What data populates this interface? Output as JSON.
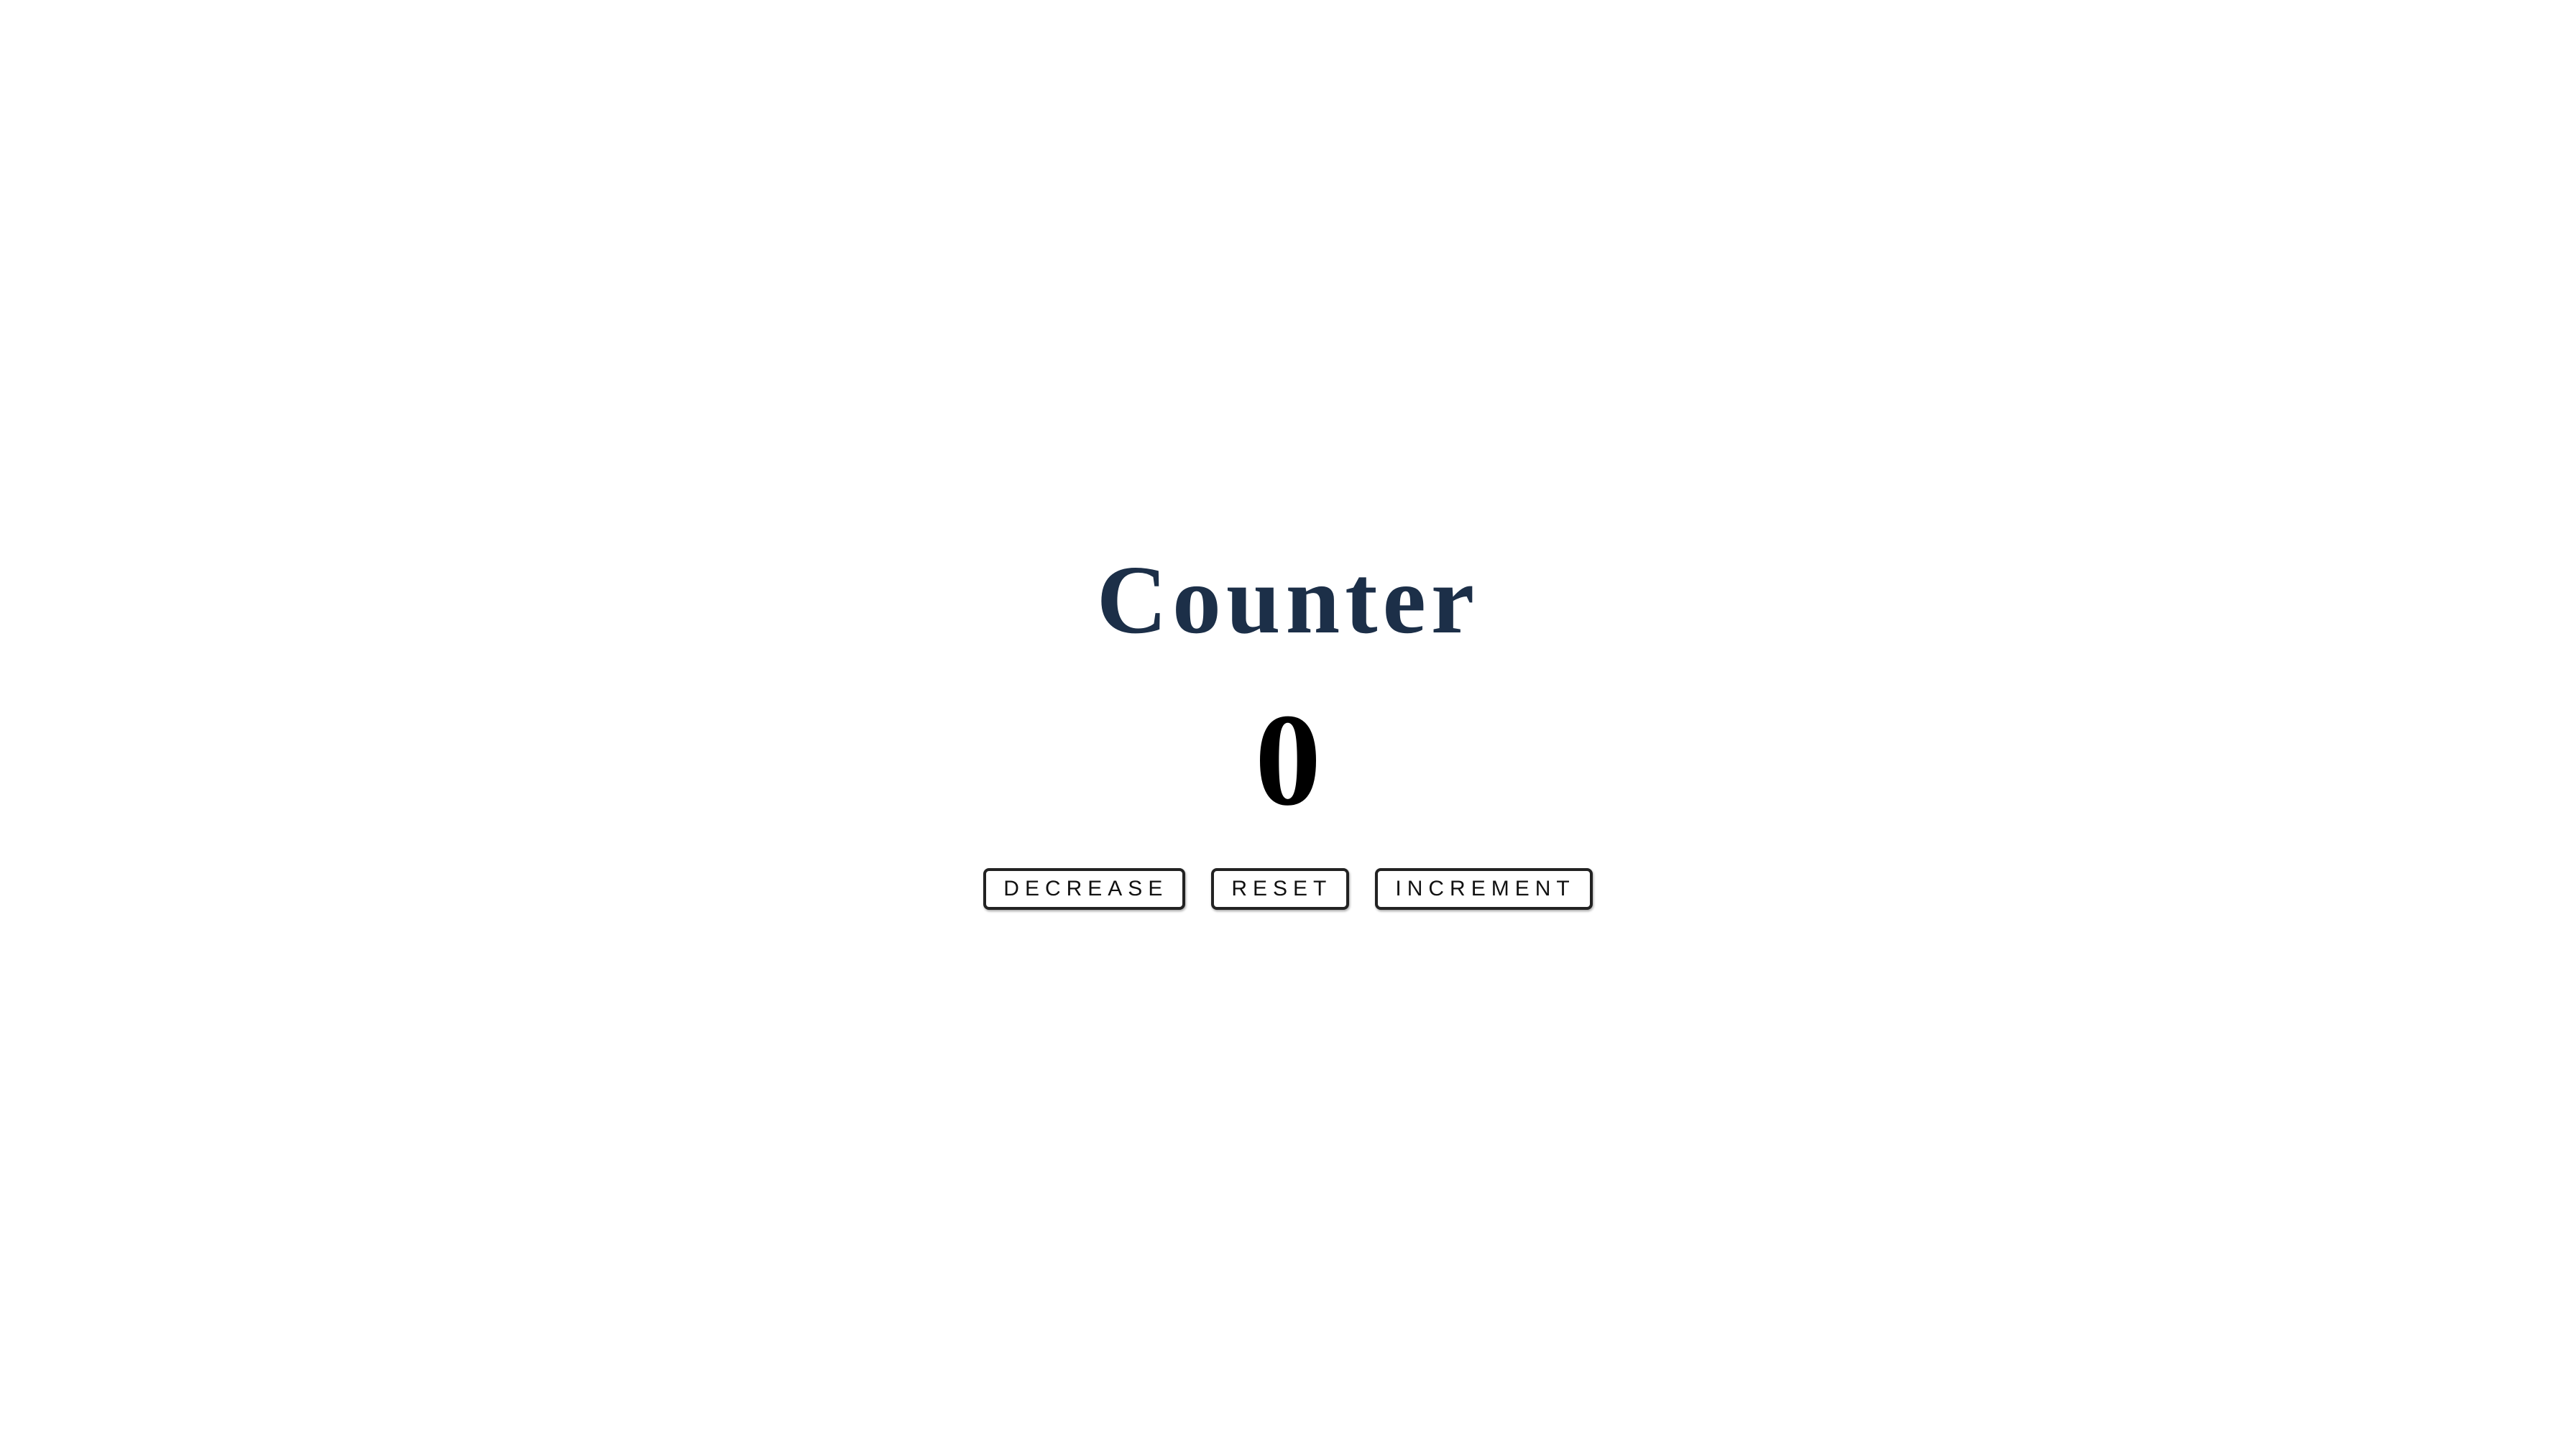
{
  "counter": {
    "title": "Counter",
    "value": "0",
    "buttons": {
      "decrease_label": "DECREASE",
      "reset_label": "RESET",
      "increment_label": "INCREMENT"
    }
  },
  "colors": {
    "title": "#1c2f48",
    "value": "#000000",
    "background": "#ffffff",
    "button_border": "#222222"
  }
}
